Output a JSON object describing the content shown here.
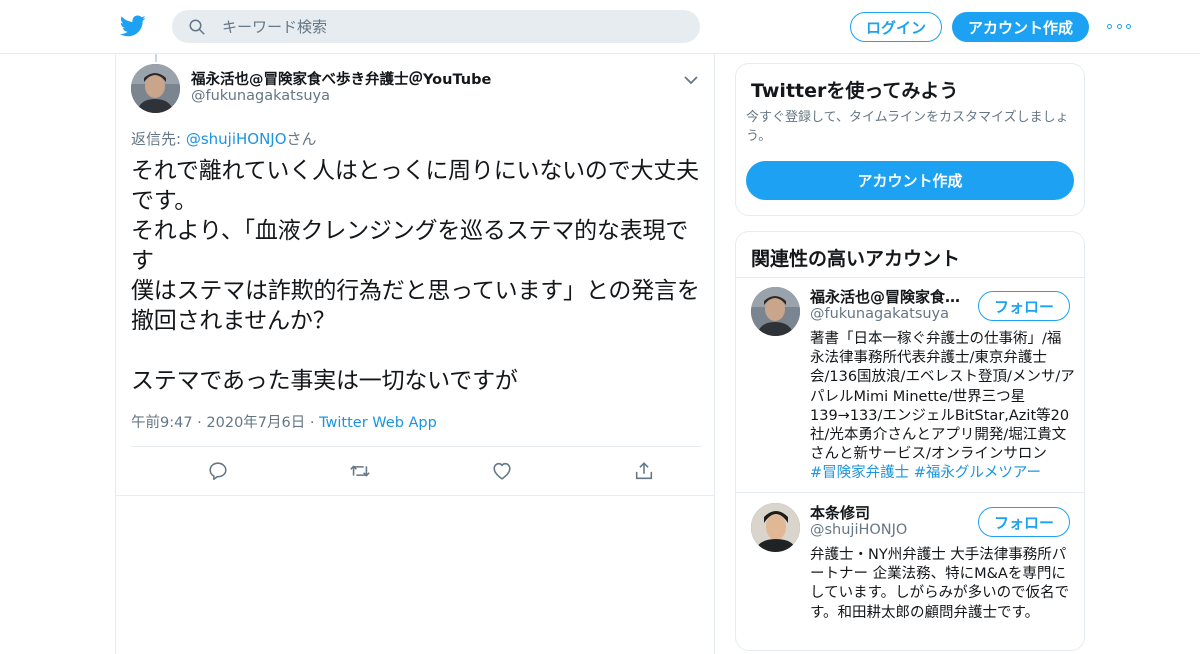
{
  "header": {
    "search_placeholder": "キーワード検索",
    "login_label": "ログイン",
    "signup_label": "アカウント作成",
    "brand_color": "#1da1f2"
  },
  "tweet": {
    "author_name": "福永活也@冒険家食べ歩き弁護士＠YouTube",
    "author_handle": "@fukunagakatsuya",
    "reply_prefix": "返信先: ",
    "reply_handle": "@shujiHONJO",
    "reply_suffix": "さん",
    "text": "それで離れていく人はとっくに周りにいないので大丈夫です。\nそれより、「血液クレンジングを巡るステマ的な表現です\n僕はステマは詐欺的行為だと思っています」との発言を撤回されませんか？\n\nステマであった事実は一切ないですが",
    "time": "午前9:47",
    "date": "2020年7月6日",
    "separator": "·",
    "app": "Twitter Web App",
    "actions": [
      "reply-icon",
      "retweet-icon",
      "like-icon",
      "share-icon"
    ]
  },
  "sidebar": {
    "signup_card": {
      "title": "Twitterを使ってみよう",
      "description": "今すぐ登録して、タイムラインをカスタマイズしましょう。",
      "button": "アカウント作成"
    },
    "related": {
      "title": "関連性の高いアカウント",
      "follow_label": "フォロー",
      "accounts": [
        {
          "name": "福永活也@冒険家食べ歩き弁護士＠YouTube",
          "handle": "@fukunagakatsuya",
          "bio": "著書「日本一稼ぐ弁護士の仕事術」/福永法律事務所代表弁護士/東京弁護士会/136国放浪/エベレスト登頂/メンサ/アパレルMimi Minette/世界三つ星139→133/エンジェルBitStar,Azit等20社/光本勇介さんとアプリ開発/堀江貴文さんと新サービス/オンラインサロン",
          "tags": "#冒険家弁護士 #福永グルメツアー"
        },
        {
          "name": "本条修司",
          "handle": "@shujiHONJO",
          "bio": "弁護士・NY州弁護士 大手法律事務所パートナー 企業法務、特にM&Aを専門にしています。しがらみが多いので仮名です。和田耕太郎の顧問弁護士です。",
          "tags": ""
        }
      ]
    }
  }
}
